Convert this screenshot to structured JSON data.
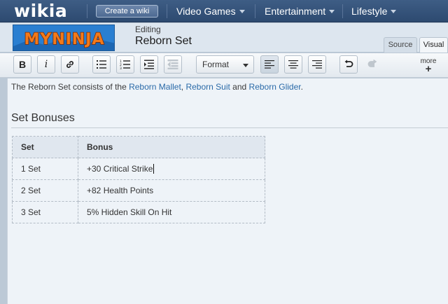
{
  "global_nav": {
    "logo": "wikia",
    "create_wiki": "Create a wiki",
    "hubs": [
      "Video Games",
      "Entertainment",
      "Lifestyle"
    ]
  },
  "editor": {
    "wiki_name": "MYNINJA",
    "editing_label": "Editing",
    "page_title": "Reborn Set",
    "tabs": {
      "source": "Source",
      "visual": "Visual"
    },
    "active_tab": "Visual"
  },
  "toolbar": {
    "bold": "B",
    "italic": "i",
    "format": "Format",
    "more": "more",
    "more_plus": "+"
  },
  "content": {
    "intro_prefix": "The Reborn Set consists of the ",
    "links": [
      "Reborn Mallet",
      "Reborn Suit",
      "Reborn Glider"
    ],
    "sep1": ", ",
    "sep2": " and ",
    "intro_suffix": ".",
    "heading": "Set Bonuses",
    "table": {
      "headers": [
        "Set",
        "Bonus"
      ],
      "rows": [
        [
          "1 Set",
          "+30 Critical Strike"
        ],
        [
          "2 Set",
          "+82 Health Points"
        ],
        [
          "3 Set",
          "5% Hidden Skill On Hit"
        ]
      ]
    }
  },
  "colors": {
    "nav": "#2d4a70",
    "link": "#2a6aa8",
    "content_bg": "#eef3f8"
  }
}
